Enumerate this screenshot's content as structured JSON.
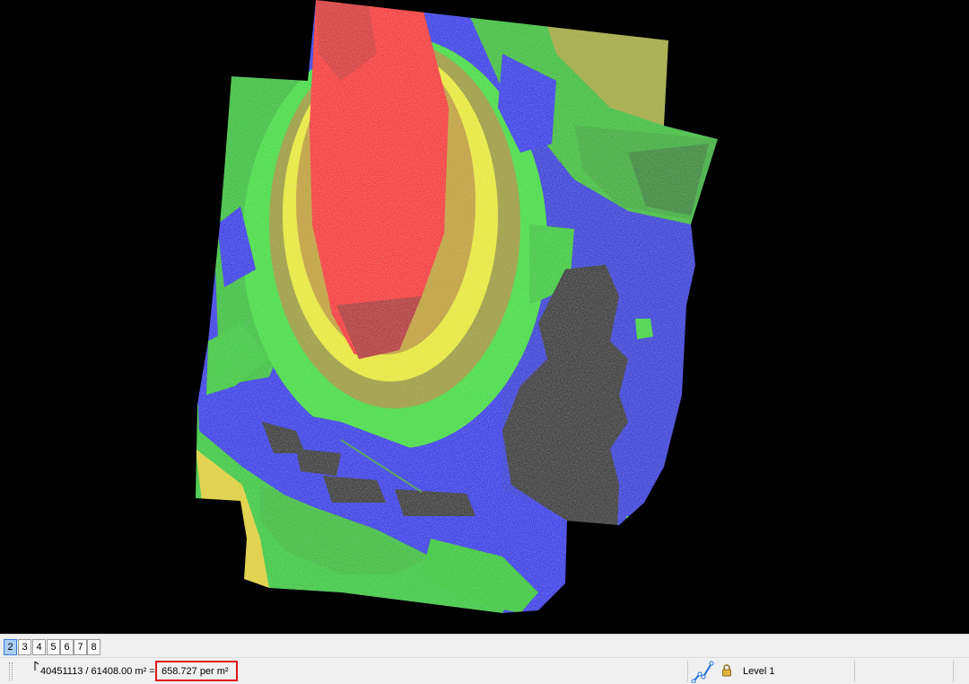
{
  "viewport": {
    "description_colors": {
      "background": "#000000",
      "low": "#0000ff",
      "low_mid": "#1f3fe8",
      "mid_low": "#00cc00",
      "mid": "#33e633",
      "mid_high": "#ffff00",
      "high": "#ff0000",
      "olive": "#999900",
      "dark_red": "#aa0000"
    }
  },
  "view_tabs": {
    "items": [
      "2",
      "3",
      "4",
      "5",
      "6",
      "7",
      "8"
    ],
    "active_index": 0,
    "active_color": "#a9cff5"
  },
  "status": {
    "count_area": "40451113 / 61408.00 m² =",
    "density": "658.727 per m²",
    "level": "Level 1",
    "highlight_color": "#e0141c",
    "tool_icon": "polyline-tool-icon",
    "lock_icon": "lock-icon"
  }
}
